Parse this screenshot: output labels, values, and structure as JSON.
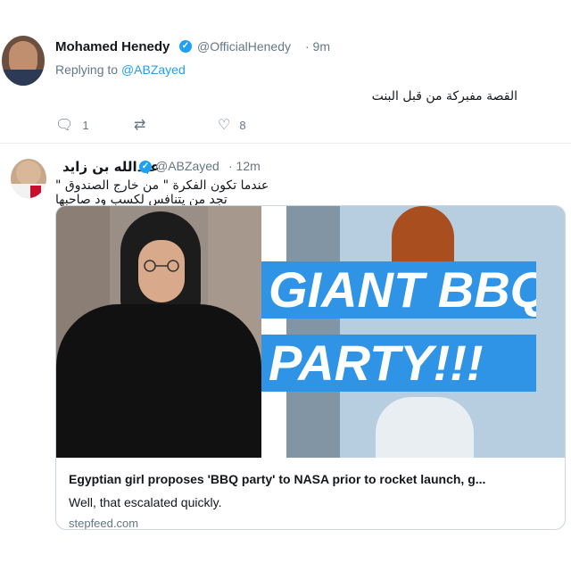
{
  "tweet1": {
    "name": "Mohamed Henedy",
    "handle": "@OfficialHenedy",
    "time": "· 9m",
    "replying_prefix": "Replying to",
    "replying_to": "@ABZayed",
    "text": "القصة مفبركة من قبل البنت",
    "actions": {
      "reply_count": "1",
      "retweet_count": "",
      "like_count": "8"
    }
  },
  "tweet2": {
    "name": "عبدالله بن زايد",
    "handle": "@ABZayed",
    "time": "· 12m",
    "text": "عندما تكون الفكرة \" من خارج الصندوق \" تجد من يتنافس لكسب ود صاحبها",
    "card": {
      "banner_line1": "GIANT BBQ",
      "banner_line2": "PARTY!!!",
      "title": "Egyptian girl proposes 'BBQ party' to NASA prior to rocket launch, g...",
      "description": "Well, that escalated quickly.",
      "domain": "stepfeed.com"
    }
  },
  "colors": {
    "accent": "#1da1f2",
    "banner": "#2f94e6",
    "muted": "#657786"
  },
  "icons": {
    "reply": "reply-icon",
    "retweet": "retweet-icon",
    "like": "heart-icon",
    "verified": "verified-badge-icon"
  }
}
